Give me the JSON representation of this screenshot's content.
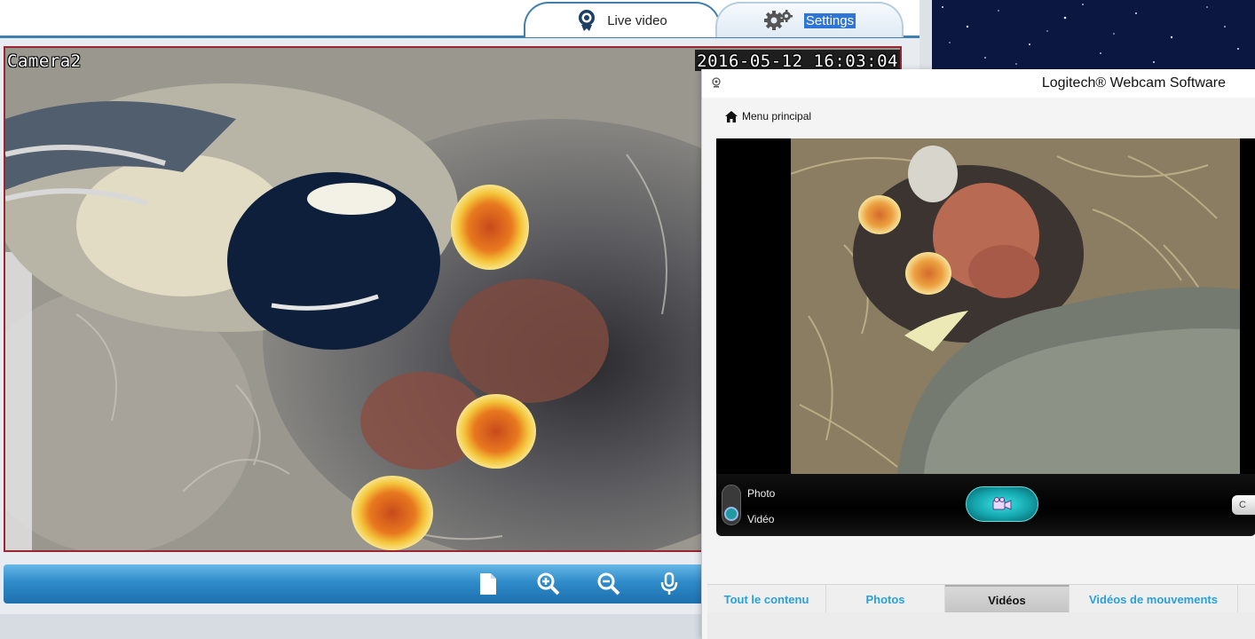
{
  "ipcam": {
    "tabs": {
      "live": "Live video",
      "settings": "Settings"
    },
    "osd": {
      "camera_name": "Camera2",
      "timestamp": "2016-05-12 16:03:04"
    },
    "toolbar_icons": [
      "snapshot-icon",
      "zoom-in-icon",
      "zoom-out-icon",
      "microphone-icon"
    ],
    "colors": {
      "header_line": "#3f7fae",
      "toolbar": "#2f8bc9",
      "frame_border": "#9b2530"
    }
  },
  "logitech": {
    "title": "Logitech® Webcam Software",
    "menu_principal": "Menu principal",
    "mode_photo": "Photo",
    "mode_video": "Vidéo",
    "side_button": "C",
    "tabs": [
      "Tout le contenu",
      "Photos",
      "Vidéos",
      "Vidéos de mouvements"
    ],
    "selected_tab": "Vidéos",
    "colors": {
      "tab_text": "#2aa0d8",
      "record_button": "#14a5ad"
    }
  }
}
